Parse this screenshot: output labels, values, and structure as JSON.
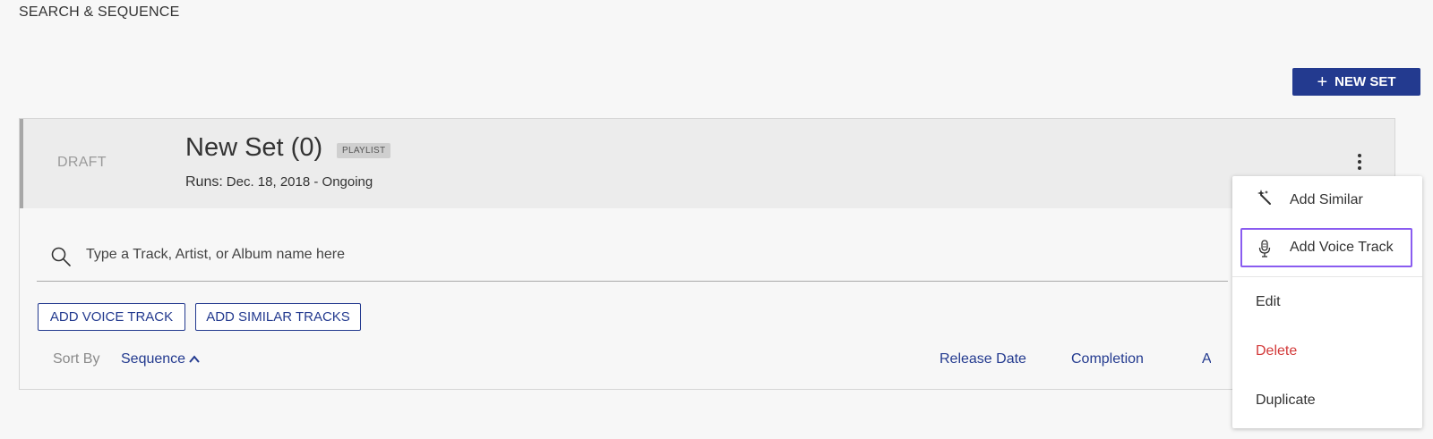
{
  "page": {
    "title": "SEARCH & SEQUENCE"
  },
  "toolbar": {
    "new_set_label": "NEW SET",
    "new_set_icon": "plus-icon"
  },
  "set_card": {
    "status": "DRAFT",
    "title": "New Set (0)",
    "type_badge": "PLAYLIST",
    "runs_label": "Runs:",
    "runs_value": "Dec. 18, 2018 - Ongoing",
    "more_icon": "kebab-menu-icon"
  },
  "search": {
    "placeholder": "Type a Track, Artist, or Album name here",
    "value": "",
    "icon": "search-icon"
  },
  "actions": {
    "add_voice_track": "ADD VOICE TRACK",
    "add_similar_tracks": "ADD SIMILAR TRACKS"
  },
  "sort": {
    "label": "Sort By",
    "columns": [
      "Sequence",
      "Release Date",
      "Completion",
      "A"
    ],
    "active": "Sequence",
    "direction_icon": "chevron-up-icon"
  },
  "context_menu": {
    "items": [
      {
        "label": "Add Similar",
        "icon": "magic-wand-icon"
      },
      {
        "label": "Add Voice Track",
        "icon": "microphone-icon",
        "highlighted": true
      },
      {
        "label": "Edit"
      },
      {
        "label": "Delete",
        "color": "#d33a3a"
      },
      {
        "label": "Duplicate"
      }
    ]
  },
  "colors": {
    "accent": "#233a8f",
    "highlight": "#8a5cf0",
    "danger": "#d33a3a"
  }
}
